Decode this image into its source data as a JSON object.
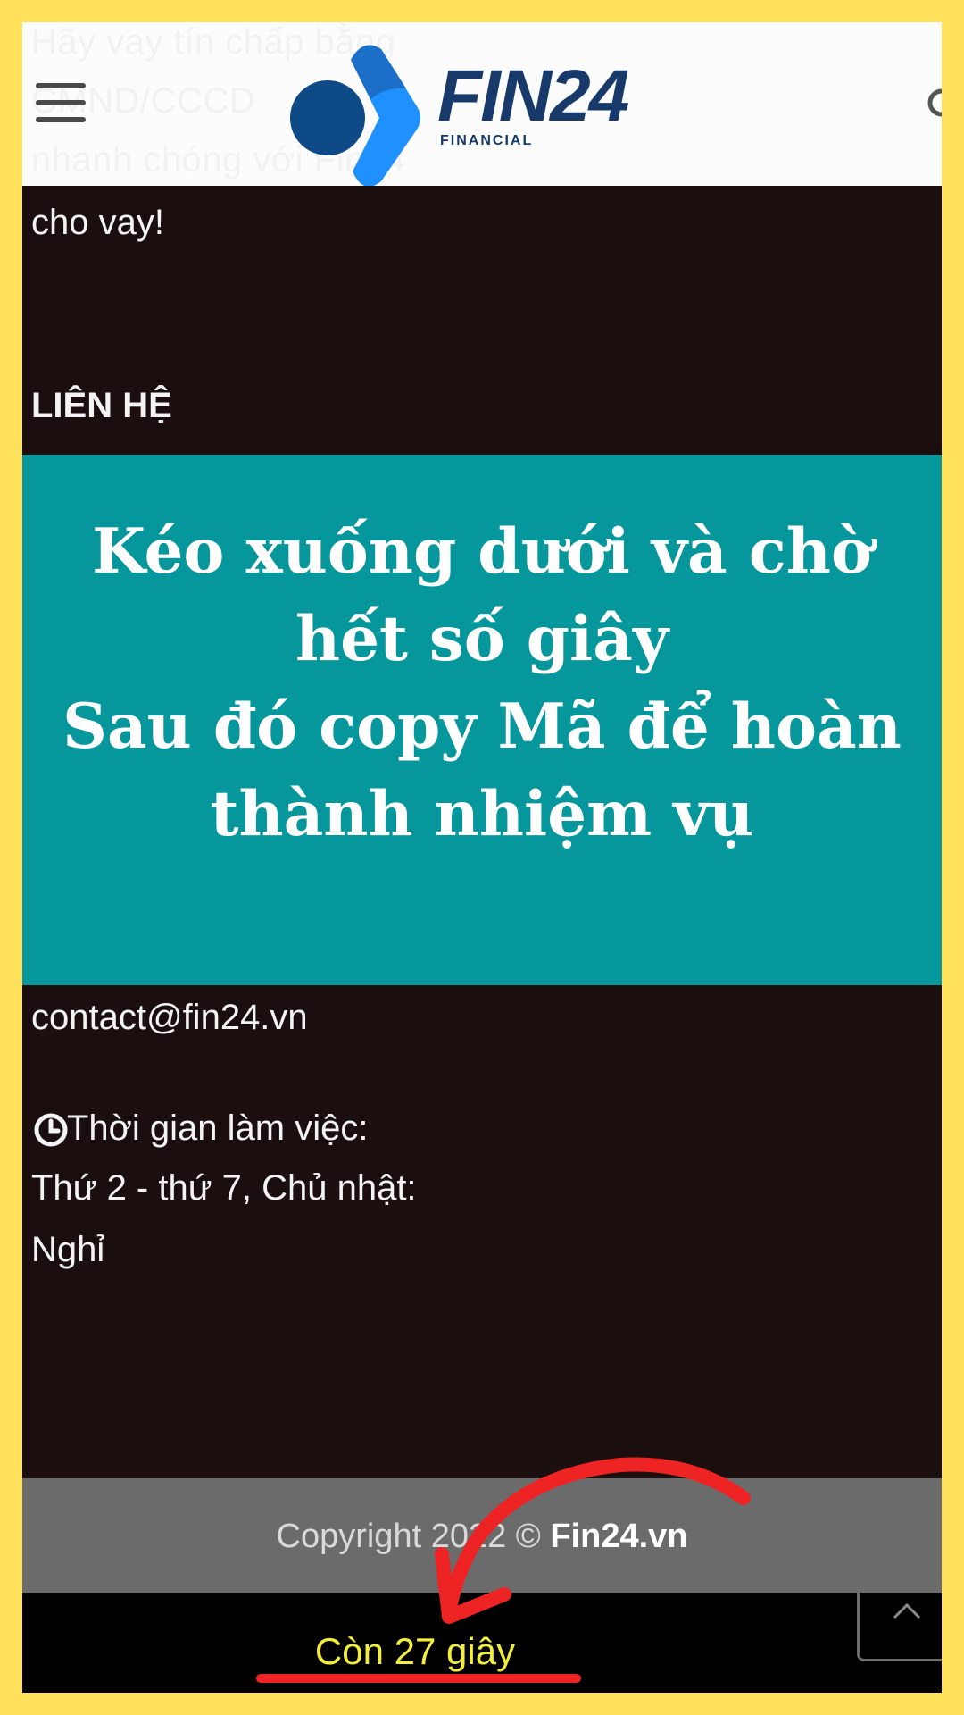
{
  "header": {
    "logo_text": "FIN24",
    "logo_sub": "FINANCIAL",
    "ghost_lines": [
      "Hãy vay tín chấp bằng",
      "CMND/CCCD",
      "nhanh chóng với Fin24"
    ]
  },
  "content": {
    "intro_tail": "cho vay!",
    "contact_heading": "LIÊN HỆ",
    "email": "contact@fin24.vn",
    "hours_label": "Thời gian làm việc:",
    "hours_line": "Thứ 2 - thứ 7, Chủ nhật:",
    "hours_closed": "Nghỉ"
  },
  "banner": {
    "lines": [
      "Kéo xuống dưới và chờ",
      "hết số giây",
      "Sau đó copy Mã để hoàn",
      "thành nhiệm vụ"
    ]
  },
  "footer": {
    "copyright_prefix": "Copyright 2022 © ",
    "copyright_brand": "Fin24.vn",
    "countdown": "Còn 27 giây"
  },
  "colors": {
    "page_border": "#ffe15c",
    "dark_bg": "#1a0f0e",
    "banner_bg": "#06979c",
    "countdown": "#f3ee3a",
    "annotation": "#ee2323",
    "logo_navy": "#173a6b",
    "logo_blue": "#1e90ff"
  },
  "icons": {
    "menu": "hamburger-menu-icon",
    "search": "search-icon",
    "clock": "clock-icon",
    "scroll_top": "chevron-up-icon"
  }
}
